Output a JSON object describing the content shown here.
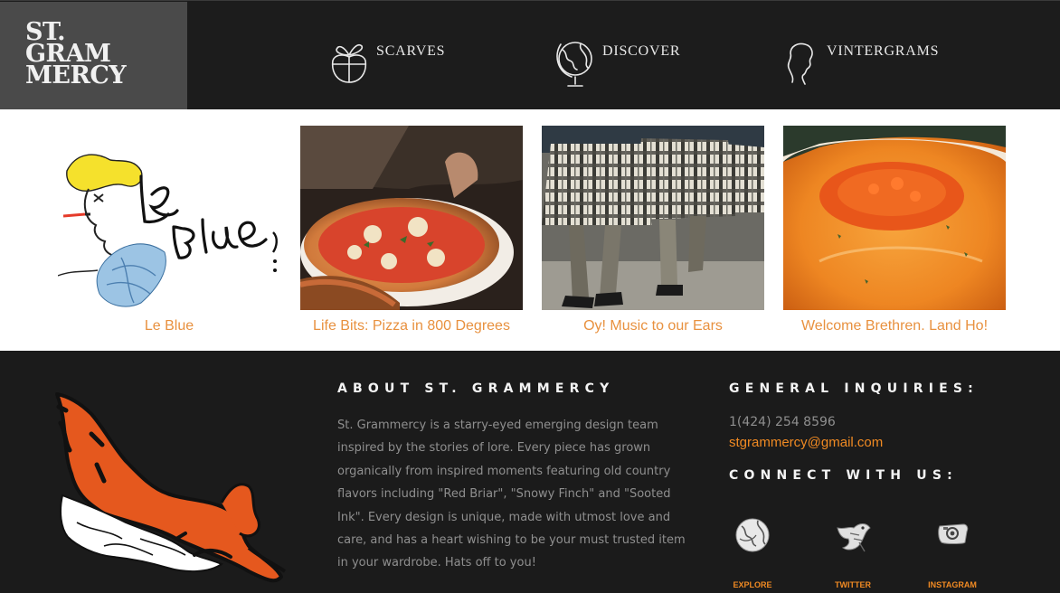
{
  "brand": {
    "line1": "ST.",
    "line2": "GRAM",
    "line3": "MERCY"
  },
  "nav": [
    {
      "label": "SCARVES",
      "icon": "gift-apple-icon"
    },
    {
      "label": "DISCOVER",
      "icon": "globe-icon"
    },
    {
      "label": "VINTERGRAMS",
      "icon": "silhouette-head-icon"
    }
  ],
  "featured": [
    {
      "caption": "Le Blue",
      "image": "le-blue-illustration"
    },
    {
      "caption": "Life Bits: Pizza in 800 Degrees",
      "image": "pizza-photo"
    },
    {
      "caption": "Oy! Music to our Ears",
      "image": "kilts-dancers-photo"
    },
    {
      "caption": "Welcome Brethren. Land Ho!",
      "image": "orange-soup-photo"
    }
  ],
  "about": {
    "heading": "ABOUT ST. GRAMMERCY",
    "body": "St. Grammercy is a starry-eyed emerging design team inspired by the stories of lore. Every piece has grown organically from inspired moments featuring old country flavors including \"Red Briar\", \"Snowy Finch\" and \"Sooted Ink\". Every design is unique, made with utmost love and care, and has a heart wishing to be your must trusted item in your wardrobe. Hats off to you!"
  },
  "inquiries": {
    "heading": "GENERAL INQUIRIES:",
    "phone": "1(424) 254 8596",
    "email": "stgrammercy@gmail.com"
  },
  "connect": {
    "heading": "CONNECT WITH US:",
    "links": [
      {
        "label": "EXPLORE",
        "icon": "globe-sketch-icon"
      },
      {
        "label": "TWITTER",
        "icon": "bird-sketch-icon"
      },
      {
        "label": "INSTAGRAM",
        "icon": "camera-sketch-icon"
      }
    ]
  },
  "colors": {
    "accent": "#f08a23",
    "caption": "#e8913f",
    "dark_bg": "#1b1b1b",
    "logo_bg": "#4a4a4a"
  }
}
